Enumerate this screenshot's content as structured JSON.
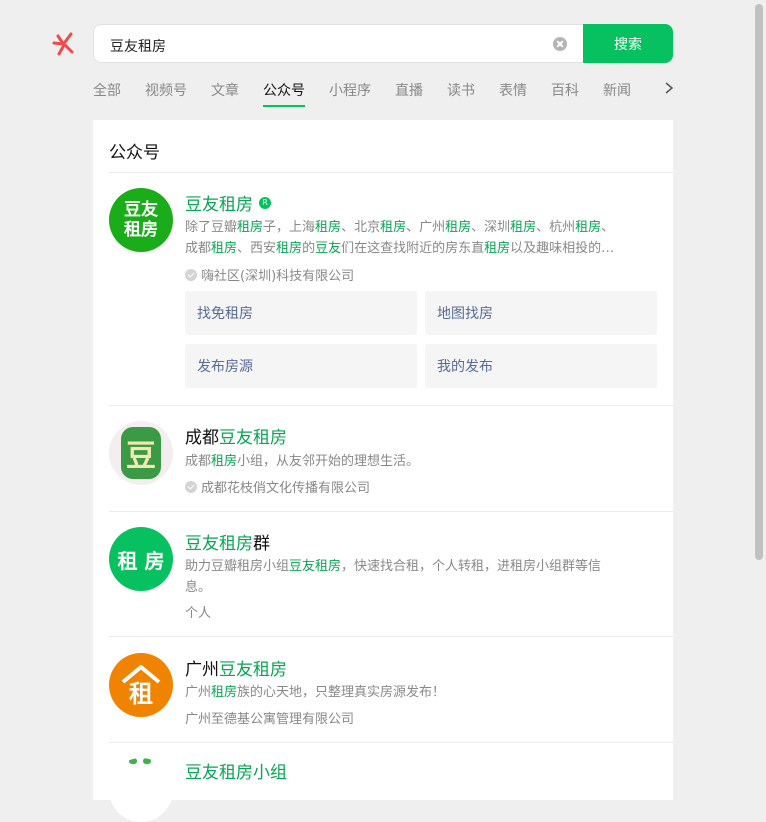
{
  "search": {
    "query": "豆友租房",
    "button_label": "搜索"
  },
  "tabs": [
    "全部",
    "视频号",
    "文章",
    "公众号",
    "小程序",
    "直播",
    "读书",
    "表情",
    "百科",
    "新闻"
  ],
  "active_tab": "公众号",
  "section_title": "公众号",
  "results": [
    {
      "name_parts": [
        "豆友租房"
      ],
      "badge": "R",
      "avatar_text": [
        "豆友",
        "租房"
      ],
      "desc_line1": [
        "除了豆瓣",
        "租房",
        "子，上海",
        "租房",
        "、北京",
        "租房",
        "、广州",
        "租房",
        "、深圳",
        "租房",
        "、杭州",
        "租房",
        "、"
      ],
      "desc_line2": [
        "成都",
        "租房",
        "、西安",
        "租房",
        "的",
        "豆友",
        "们在这查找附近的房东直",
        "租房",
        "以及趣味相投的…"
      ],
      "company": "嗨社区(深圳)科技有限公司",
      "menu": [
        "找免租房",
        "地图找房",
        "发布房源",
        "我的发布"
      ]
    },
    {
      "name_plain": "成都",
      "name_hl": "豆友租房",
      "avatar_text": "豆",
      "desc": [
        "成都",
        "租房",
        "小组，从友邻开始的理想生活。"
      ],
      "company": "成都花枝俏文化传播有限公司"
    },
    {
      "name_hl": "豆友租房",
      "name_plain": "群",
      "avatar_text": "租 房",
      "desc_line1": [
        "助力豆瓣租房小组",
        "豆友租房",
        "，快速找合租，个人转租，进租房小组群等信"
      ],
      "desc_line2": "息。",
      "company": "个人"
    },
    {
      "name_plain": "广州",
      "name_hl": "豆友租房",
      "avatar_text": "租",
      "desc": [
        "广州",
        "租房",
        "族的心天地，只整理真实房源发布！"
      ],
      "company": "广州至德基公寓管理有限公司"
    },
    {
      "name_partial": "豆友租房小组"
    }
  ],
  "colors": {
    "accent": "#07c160",
    "highlight": "#07a553",
    "link": "#576b95"
  }
}
